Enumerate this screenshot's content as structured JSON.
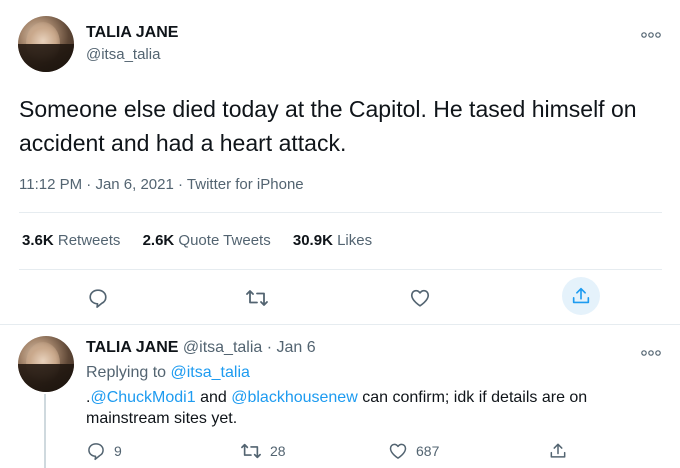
{
  "main_tweet": {
    "author_name": "TALIA JANE",
    "handle": "@itsa_talia",
    "text": "Someone else died today at the Capitol. He tased himself on accident and had a heart attack.",
    "time": "11:12 PM",
    "date": "Jan 6, 2021",
    "source": "Twitter for iPhone",
    "stats": {
      "retweets_count": "3.6K",
      "retweets_label": "Retweets",
      "quotes_count": "2.6K",
      "quotes_label": "Quote Tweets",
      "likes_count": "30.9K",
      "likes_label": "Likes"
    }
  },
  "reply": {
    "author_name": "TALIA JANE",
    "handle": "@itsa_talia",
    "date": "Jan 6",
    "replying_prefix": "Replying to",
    "replying_to": "@itsa_talia",
    "text_prefix": ".",
    "mention1": "@ChuckModi1",
    "text_and": " and ",
    "mention2": "@blackhousenew",
    "text_rest": " can confirm; idk if details are on mainstream sites yet.",
    "reply_count": "9",
    "retweet_count": "28",
    "like_count": "687"
  },
  "colors": {
    "link": "#1d9bf0",
    "secondary_text": "#536471",
    "primary_text": "#0f1419",
    "share_highlight": "#e5f2fb"
  },
  "icons": [
    "more-icon",
    "reply-icon",
    "retweet-icon",
    "like-icon",
    "share-icon"
  ]
}
